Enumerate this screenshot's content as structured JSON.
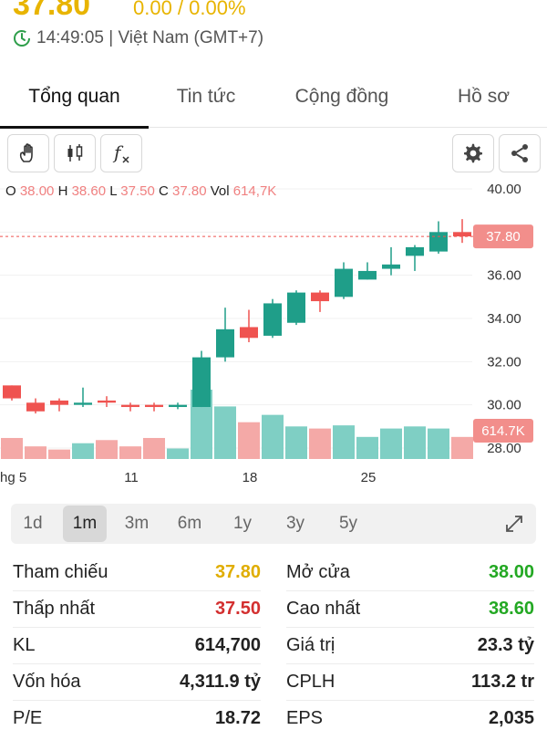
{
  "header": {
    "price": "37.80",
    "change": "0.00 / 0.00%",
    "time": "14:49:05 | Việt Nam (GMT+7)"
  },
  "tabs": [
    {
      "label": "Tổng quan",
      "active": true
    },
    {
      "label": "Tin tức",
      "active": false
    },
    {
      "label": "Cộng đồng",
      "active": false
    },
    {
      "label": "Hồ sơ",
      "active": false
    }
  ],
  "toolbar": {
    "left_tools": [
      "hand-icon",
      "candlestick-icon",
      "function-icon"
    ],
    "right_tools": [
      "gear-icon",
      "share-icon"
    ],
    "fx_label": "f"
  },
  "ohlc": {
    "o_label": "O",
    "o": "38.00",
    "h_label": "H",
    "h": "38.60",
    "l_label": "L",
    "l": "37.50",
    "c_label": "C",
    "c": "37.80",
    "vol_label": "Vol",
    "vol": "614,7K"
  },
  "chart_data": {
    "type": "candlestick",
    "y_ticks": [
      "40.00",
      "38.00",
      "36.00",
      "34.00",
      "32.00",
      "30.00",
      "28.00"
    ],
    "y_tick_values": [
      40,
      38,
      36,
      34,
      32,
      30,
      28
    ],
    "ylim": [
      27.5,
      40.5
    ],
    "x_ticks": [
      {
        "label": "hg 5",
        "index": 0
      },
      {
        "label": "11",
        "index": 5
      },
      {
        "label": "18",
        "index": 10
      },
      {
        "label": "25",
        "index": 15
      }
    ],
    "last_price": 37.8,
    "last_price_label": "37.80",
    "last_volume_label": "614.7K",
    "candles": [
      {
        "o": 30.9,
        "h": 30.9,
        "l": 30.2,
        "c": 30.3,
        "v": 0.2
      },
      {
        "o": 30.1,
        "h": 30.3,
        "l": 29.6,
        "c": 29.7,
        "v": 0.12
      },
      {
        "o": 30.2,
        "h": 30.3,
        "l": 29.7,
        "c": 30.0,
        "v": 0.09
      },
      {
        "o": 30.0,
        "h": 30.8,
        "l": 29.9,
        "c": 30.1,
        "v": 0.15
      },
      {
        "o": 30.2,
        "h": 30.4,
        "l": 29.9,
        "c": 30.1,
        "v": 0.18
      },
      {
        "o": 30.0,
        "h": 30.1,
        "l": 29.7,
        "c": 29.9,
        "v": 0.12
      },
      {
        "o": 30.0,
        "h": 30.1,
        "l": 29.7,
        "c": 29.9,
        "v": 0.2
      },
      {
        "o": 29.9,
        "h": 30.1,
        "l": 29.8,
        "c": 30.0,
        "v": 0.1
      },
      {
        "o": 29.9,
        "h": 32.5,
        "l": 29.9,
        "c": 32.2,
        "v": 0.66
      },
      {
        "o": 32.2,
        "h": 34.5,
        "l": 32.0,
        "c": 33.5,
        "v": 0.5
      },
      {
        "o": 33.6,
        "h": 34.4,
        "l": 32.9,
        "c": 33.1,
        "v": 0.35
      },
      {
        "o": 33.2,
        "h": 34.9,
        "l": 33.1,
        "c": 34.7,
        "v": 0.42
      },
      {
        "o": 33.8,
        "h": 35.3,
        "l": 33.7,
        "c": 35.2,
        "v": 0.31
      },
      {
        "o": 35.2,
        "h": 35.3,
        "l": 34.3,
        "c": 34.8,
        "v": 0.29
      },
      {
        "o": 35.0,
        "h": 36.6,
        "l": 34.9,
        "c": 36.3,
        "v": 0.32
      },
      {
        "o": 35.8,
        "h": 36.6,
        "l": 35.8,
        "c": 36.2,
        "v": 0.21
      },
      {
        "o": 36.3,
        "h": 37.3,
        "l": 36.0,
        "c": 36.5,
        "v": 0.29
      },
      {
        "o": 36.9,
        "h": 37.4,
        "l": 36.2,
        "c": 37.3,
        "v": 0.31
      },
      {
        "o": 37.1,
        "h": 38.5,
        "l": 37.0,
        "c": 38.0,
        "v": 0.29
      },
      {
        "o": 38.0,
        "h": 38.6,
        "l": 37.5,
        "c": 37.8,
        "v": 0.21
      }
    ],
    "colors": {
      "up": "#1f9e89",
      "down": "#ef5350",
      "vol_up": "#7fcfc4",
      "vol_down": "#f4a9a7",
      "last_line": "#ef5350",
      "label_bg": "#f28e8b"
    }
  },
  "periods": [
    {
      "label": "1d",
      "active": false
    },
    {
      "label": "1m",
      "active": true
    },
    {
      "label": "3m",
      "active": false
    },
    {
      "label": "6m",
      "active": false
    },
    {
      "label": "1y",
      "active": false
    },
    {
      "label": "3y",
      "active": false
    },
    {
      "label": "5y",
      "active": false
    }
  ],
  "stats": {
    "left": [
      {
        "key": "Tham chiếu",
        "value": "37.80",
        "color": "yellow"
      },
      {
        "key": "Thấp nhất",
        "value": "37.50",
        "color": "red"
      },
      {
        "key": "KL",
        "value": "614,700",
        "color": "default"
      },
      {
        "key": "Vốn hóa",
        "value": "4,311.9 tỷ",
        "color": "default"
      },
      {
        "key": "P/E",
        "value": "18.72",
        "color": "default"
      }
    ],
    "right": [
      {
        "key": "Mở cửa",
        "value": "38.00",
        "color": "green"
      },
      {
        "key": "Cao nhất",
        "value": "38.60",
        "color": "green"
      },
      {
        "key": "Giá trị",
        "value": "23.3 tỷ",
        "color": "default"
      },
      {
        "key": "CPLH",
        "value": "113.2 tr",
        "color": "default"
      },
      {
        "key": "EPS",
        "value": "2,035",
        "color": "default"
      }
    ]
  }
}
